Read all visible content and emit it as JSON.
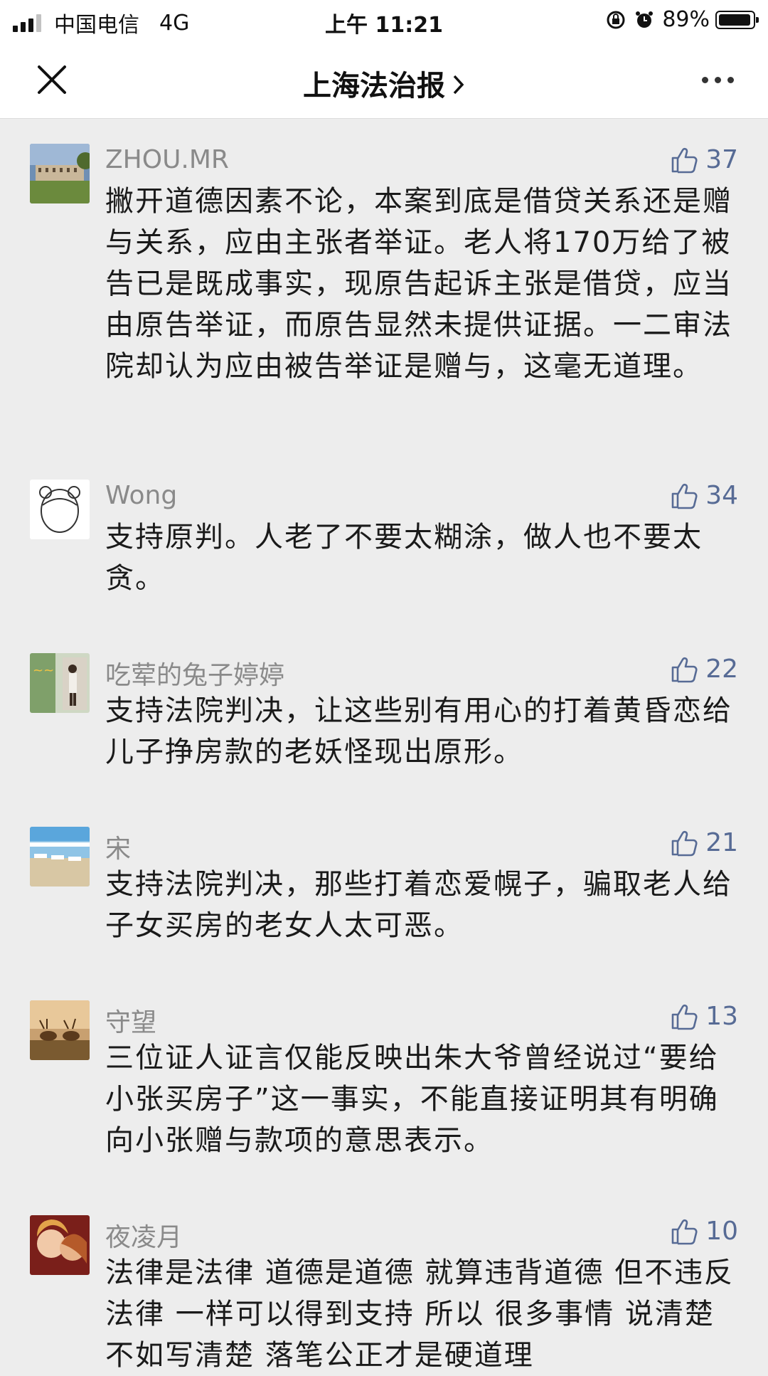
{
  "status_bar": {
    "carrier": "中国电信",
    "network": "4G",
    "time": "上午 11:21",
    "battery_percent": "89%",
    "battery_level": 0.89
  },
  "nav": {
    "title": "上海法治报",
    "close_icon": "close-icon",
    "more_icon": "more-icon"
  },
  "comments": [
    {
      "name": "ZHOU.MR",
      "likes": "37",
      "text": "撇开道德因素不论，本案到底是借贷关系还是赠与关系，应由主张者举证。老人将170万给了被告已是既成事实，现原告起诉主张是借贷，应当由原告举证，而原告显然未提供证据。一二审法院却认为应由被告举证是赠与，这毫无道理。"
    },
    {
      "name": "Wong",
      "likes": "34",
      "text": "支持原判。人老了不要太糊涂，做人也不要太贪。"
    },
    {
      "name": "吃荤的兔子婷婷",
      "likes": "22",
      "text": "支持法院判决，让这些别有用心的打着黄昏恋给儿子挣房款的老妖怪现出原形。"
    },
    {
      "name": "宋",
      "likes": "21",
      "text": "支持法院判决，那些打着恋爱幌子，骗取老人给子女买房的老女人太可恶。"
    },
    {
      "name": "守望",
      "likes": "13",
      "text": "三位证人证言仅能反映出朱大爷曾经说过“要给小张买房子”这一事实，不能直接证明其有明确向小张赠与款项的意思表示。"
    },
    {
      "name": "夜凌月",
      "likes": "10",
      "text": "法律是法律 道德是道德 就算违背道德 但不违反法律 一样可以得到支持 所以 很多事情 说清楚 不如写清楚 落笔公正才是硬道理"
    }
  ],
  "colors": {
    "like_blue": "#576b95",
    "name_gray": "#8a8a8a",
    "background": "#ededed"
  }
}
